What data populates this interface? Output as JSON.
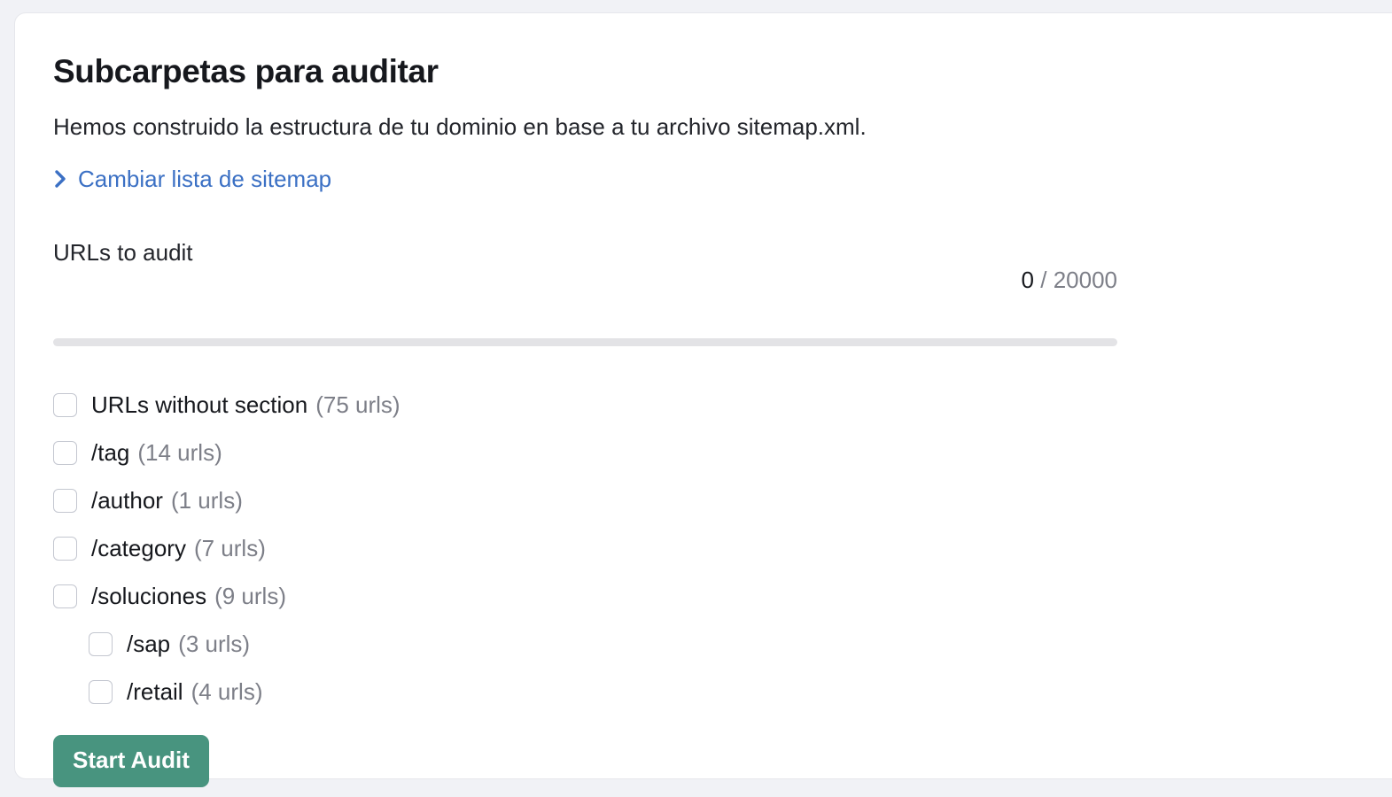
{
  "card": {
    "title": "Subcarpetas para auditar",
    "subtitle": "Hemos construido la estructura de tu dominio en base a tu archivo sitemap.xml.",
    "sitemap_link": {
      "label": "Cambiar lista de sitemap",
      "icon": "chevron-right-icon",
      "color": "#3b70c4"
    },
    "progress": {
      "label": "URLs to audit",
      "current": "0",
      "separator": " / ",
      "limit": "20000",
      "percent": 0,
      "track_color": "#e3e3e6",
      "fill_color": "#4a9580"
    },
    "folders": [
      {
        "label": "URLs without section",
        "count": "(75 urls)",
        "depth": 0,
        "checked": false
      },
      {
        "label": "/tag",
        "count": "(14 urls)",
        "depth": 0,
        "checked": false
      },
      {
        "label": "/author",
        "count": "(1 urls)",
        "depth": 0,
        "checked": false
      },
      {
        "label": "/category",
        "count": "(7 urls)",
        "depth": 0,
        "checked": false
      },
      {
        "label": "/soluciones",
        "count": "(9 urls)",
        "depth": 0,
        "checked": false
      },
      {
        "label": "/sap",
        "count": "(3 urls)",
        "depth": 1,
        "checked": false
      },
      {
        "label": "/retail",
        "count": "(4 urls)",
        "depth": 1,
        "checked": false
      }
    ],
    "start_button": {
      "label": "Start Audit",
      "color": "#48947f"
    }
  }
}
